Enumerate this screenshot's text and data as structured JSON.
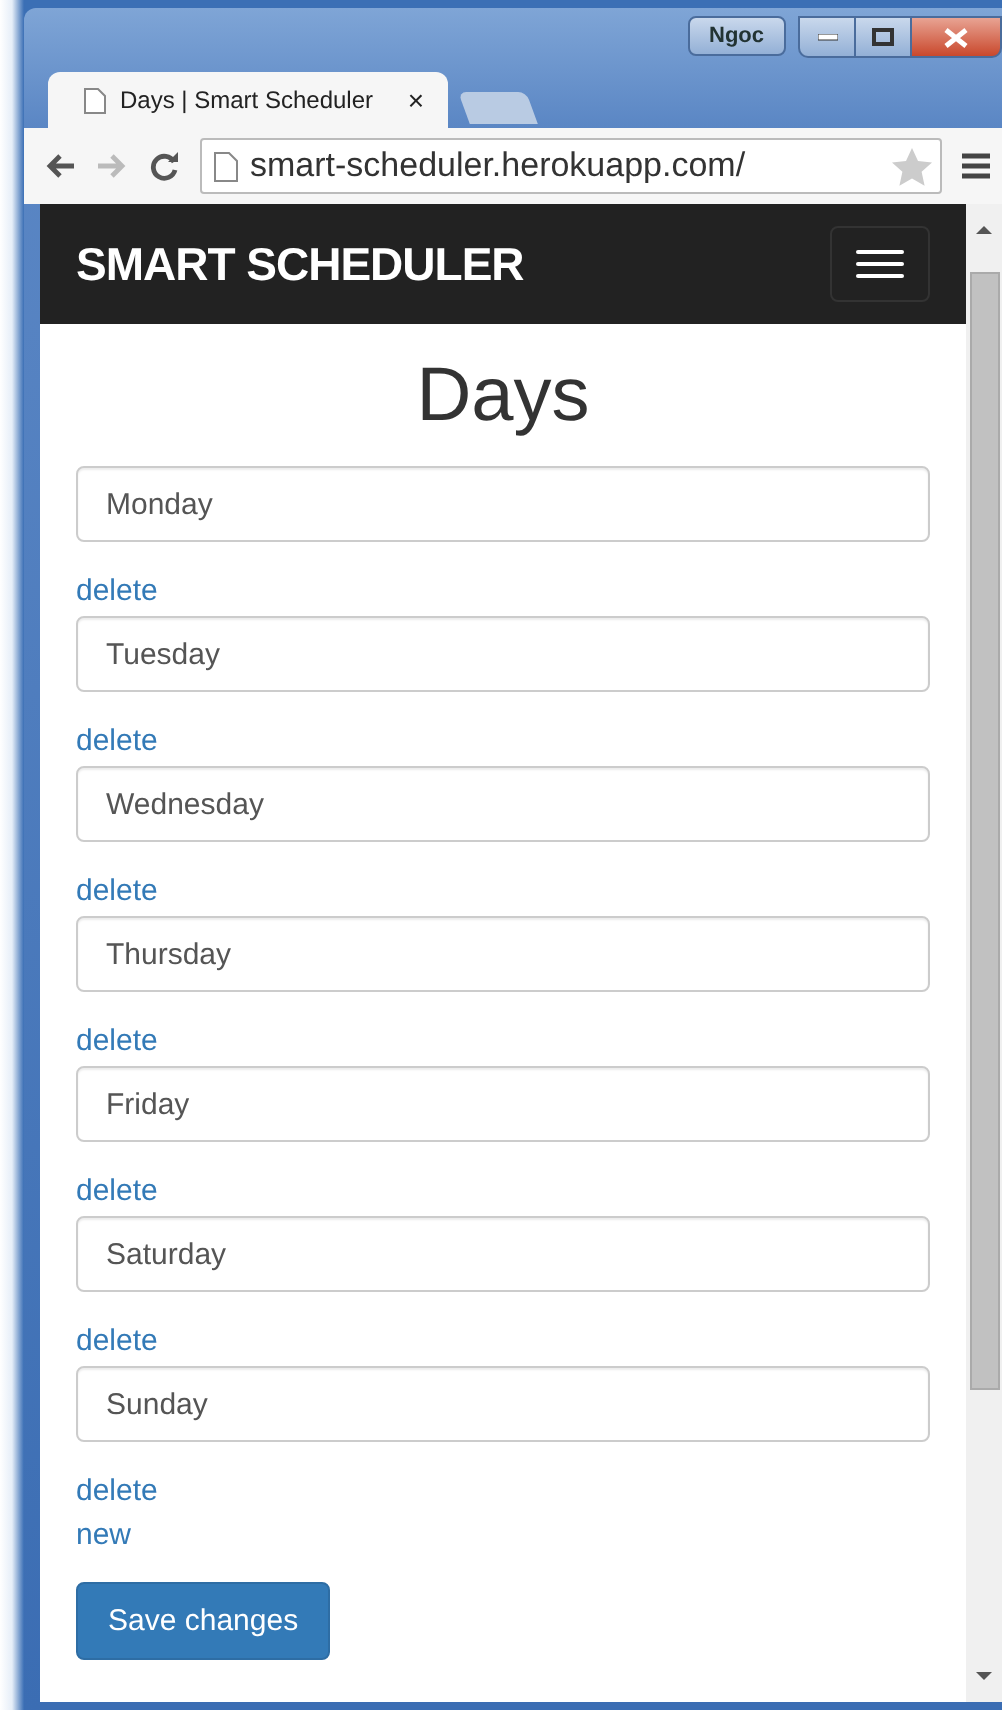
{
  "window": {
    "user": "Ngoc"
  },
  "tabs": [
    {
      "title": "Days | Smart Scheduler",
      "close": "×",
      "selected": true
    }
  ],
  "address_bar": {
    "url": "smart-scheduler.herokuapp.com/"
  },
  "navbar": {
    "brand": "SMART SCHEDULER"
  },
  "page": {
    "title": "Days",
    "days": [
      {
        "value": "Monday",
        "link": "delete"
      },
      {
        "value": "Tuesday",
        "link": "delete"
      },
      {
        "value": "Wednesday",
        "link": "delete"
      },
      {
        "value": "Thursday",
        "link": "delete"
      },
      {
        "value": "Friday",
        "link": "delete"
      },
      {
        "value": "Saturday",
        "link": "delete"
      },
      {
        "value": "Sunday",
        "link": "delete"
      }
    ],
    "new_link": "new",
    "save_button": "Save changes"
  }
}
